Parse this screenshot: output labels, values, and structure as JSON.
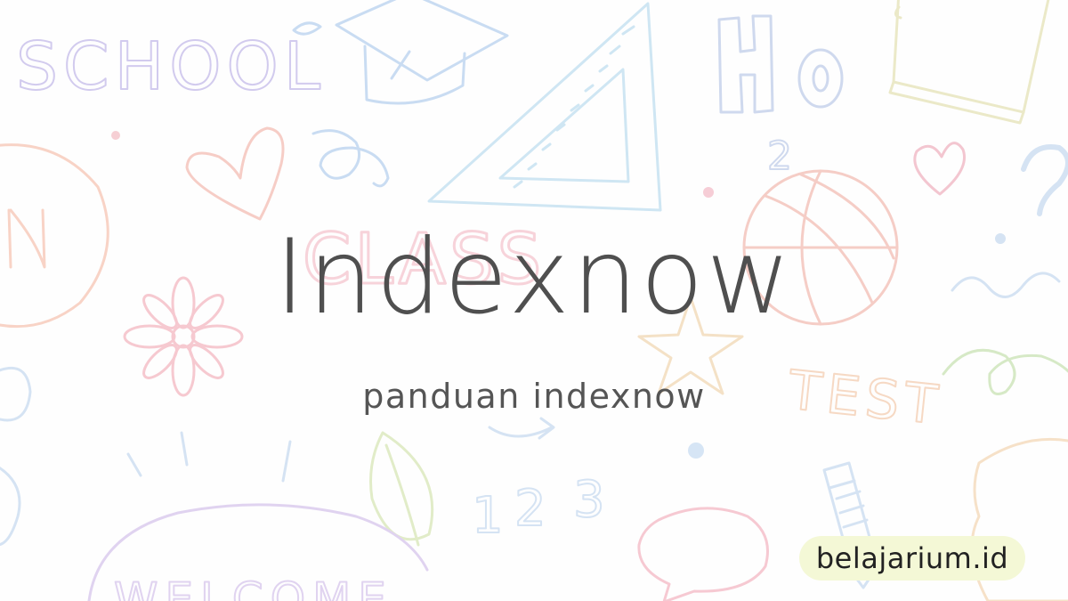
{
  "hero": {
    "title": "Indexnow",
    "subtitle": "panduan indexnow"
  },
  "brand": {
    "label": "belajarium.id",
    "badge_color": "#f4f8d6"
  },
  "background": {
    "doodle_words": [
      "SCHOOL",
      "H",
      "O",
      "2",
      "UN",
      "CLASS",
      "TEST",
      "1",
      "2",
      "3",
      "?",
      "WELCOME"
    ],
    "doodle_icons": [
      "graduation-cap-icon",
      "set-square-icon",
      "notebook-icon",
      "heart-icon",
      "basketball-icon",
      "flower-icon",
      "star-icon",
      "leaf-icon",
      "pencil-icon",
      "speech-bubble-icon",
      "swirl-icon",
      "arrow-icon"
    ]
  },
  "colors": {
    "title": "#4f4f4f",
    "subtitle": "#555555",
    "doodle_lilac": "#cfc6ec",
    "doodle_blue": "#c9dcf2",
    "doodle_pink": "#f6c9c9",
    "doodle_peach": "#f7d9c0",
    "doodle_green": "#d6e9c6",
    "doodle_yellow": "#f1ecc2"
  }
}
